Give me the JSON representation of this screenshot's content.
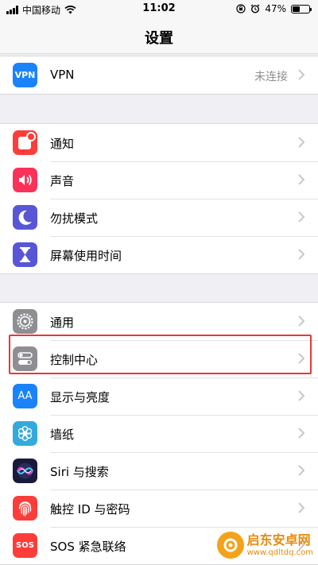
{
  "status": {
    "carrier": "中国移动",
    "time": "11:02",
    "battery": "47%",
    "battery_level": 0.47
  },
  "nav": {
    "title": "设置"
  },
  "sections": [
    {
      "items": [
        {
          "label": "VPN",
          "value": "未连接",
          "icon": "vpn-icon",
          "icon_text": "VPN",
          "color": "#1a82fb"
        }
      ]
    },
    {
      "items": [
        {
          "label": "通知",
          "icon": "notifications-icon",
          "color": "#fc3d39"
        },
        {
          "label": "声音",
          "icon": "sounds-icon",
          "color": "#fc3159"
        },
        {
          "label": "勿扰模式",
          "icon": "do-not-disturb-moon-icon",
          "color": "#5856d6"
        },
        {
          "label": "屏幕使用时间",
          "icon": "screen-time-hourglass-icon",
          "color": "#5856d6"
        }
      ]
    },
    {
      "items": [
        {
          "label": "通用",
          "icon": "general-gear-icon",
          "color": "#8e8e93"
        },
        {
          "label": "控制中心",
          "icon": "control-center-toggles-icon",
          "color": "#8e8e93"
        },
        {
          "label": "显示与亮度",
          "icon": "display-brightness-aa-icon",
          "icon_text": "AA",
          "color": "#1a82fb"
        },
        {
          "label": "墙纸",
          "icon": "wallpaper-flower-icon",
          "color": "#34aadc"
        },
        {
          "label": "Siri 与搜索",
          "icon": "siri-icon",
          "color": "#1a1a3a"
        },
        {
          "label": "触控 ID 与密码",
          "icon": "touch-id-fingerprint-icon",
          "color": "#fc3d39"
        },
        {
          "label": "SOS 紧急联络",
          "icon": "sos-icon",
          "icon_text": "SOS",
          "color": "#fc3d39"
        }
      ]
    }
  ],
  "watermark": {
    "name": "启东安卓网",
    "url": "www.qdltdq.com"
  }
}
